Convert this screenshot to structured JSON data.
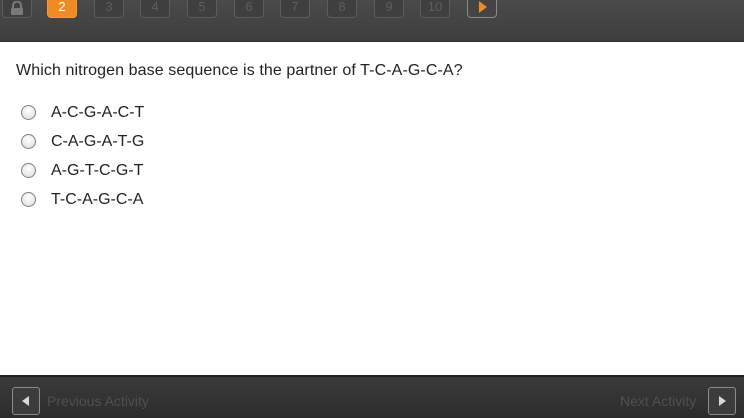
{
  "nav": {
    "lock_icon": "lock-icon",
    "questions": [
      {
        "label": "2",
        "active": true
      },
      {
        "label": "3",
        "active": false
      },
      {
        "label": "4",
        "active": false
      },
      {
        "label": "5",
        "active": false
      },
      {
        "label": "6",
        "active": false
      },
      {
        "label": "7",
        "active": false
      },
      {
        "label": "8",
        "active": false
      },
      {
        "label": "9",
        "active": false
      },
      {
        "label": "10",
        "active": false
      }
    ],
    "next_icon": "play-arrow-icon",
    "active_color": "#f08a24"
  },
  "question": {
    "text": "Which nitrogen base sequence is the partner of T-C-A-G-C-A?",
    "options": [
      {
        "label": "A-C-G-A-C-T"
      },
      {
        "label": "C-A-G-A-T-G"
      },
      {
        "label": "A-G-T-C-G-T"
      },
      {
        "label": "T-C-A-G-C-A"
      }
    ]
  },
  "footer": {
    "previous_label": "Previous Activity",
    "next_label": "Next Activity"
  }
}
